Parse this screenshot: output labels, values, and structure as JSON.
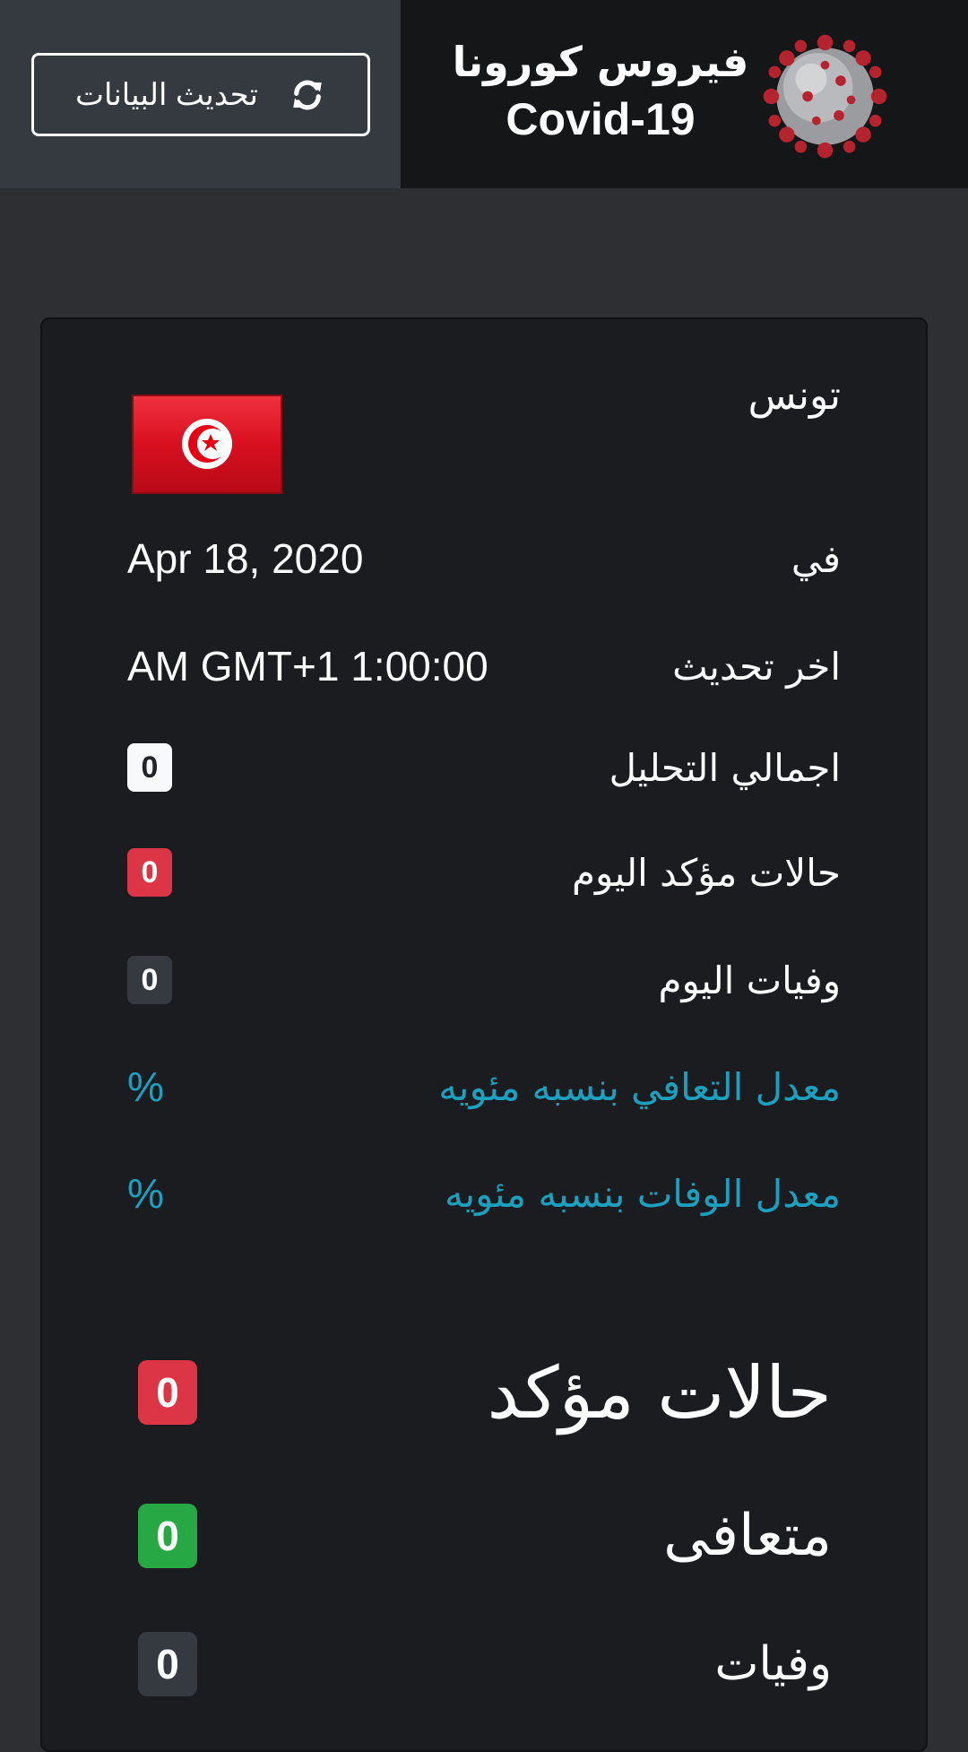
{
  "header": {
    "refresh_label": "تحديث البيانات",
    "title_ar": "فيروس كورونا",
    "title_en": "Covid-19"
  },
  "country": {
    "name": "تونس"
  },
  "details": {
    "date_label": "في",
    "date_value": "Apr 18, 2020",
    "updated_label": "اخر تحديث",
    "updated_value": "AM GMT+1 1:00:00",
    "total_tests_label": "اجمالي التحليل",
    "total_tests_value": "0",
    "today_cases_label": "حالات مؤكد اليوم",
    "today_cases_value": "0",
    "today_deaths_label": "وفيات اليوم",
    "today_deaths_value": "0",
    "recovery_rate_label": "معدل التعافي بنسبه مئويه",
    "recovery_rate_value": "%",
    "death_rate_label": "معدل الوفات بنسبه مئويه",
    "death_rate_value": "%"
  },
  "totals": {
    "confirmed_label": "حالات مؤكد",
    "confirmed_value": "0",
    "recovered_label": "متعافى",
    "recovered_value": "0",
    "deaths_label": "وفيات",
    "deaths_value": "0"
  },
  "colors": {
    "accent_info": "#1ba1bf",
    "danger": "#dc3545",
    "success": "#28a745",
    "dark": "#343a40",
    "flag_red": "#e70013"
  },
  "icons": {
    "refresh": "refresh-icon",
    "virus": "virus-logo",
    "flag": "tunisia-flag"
  }
}
